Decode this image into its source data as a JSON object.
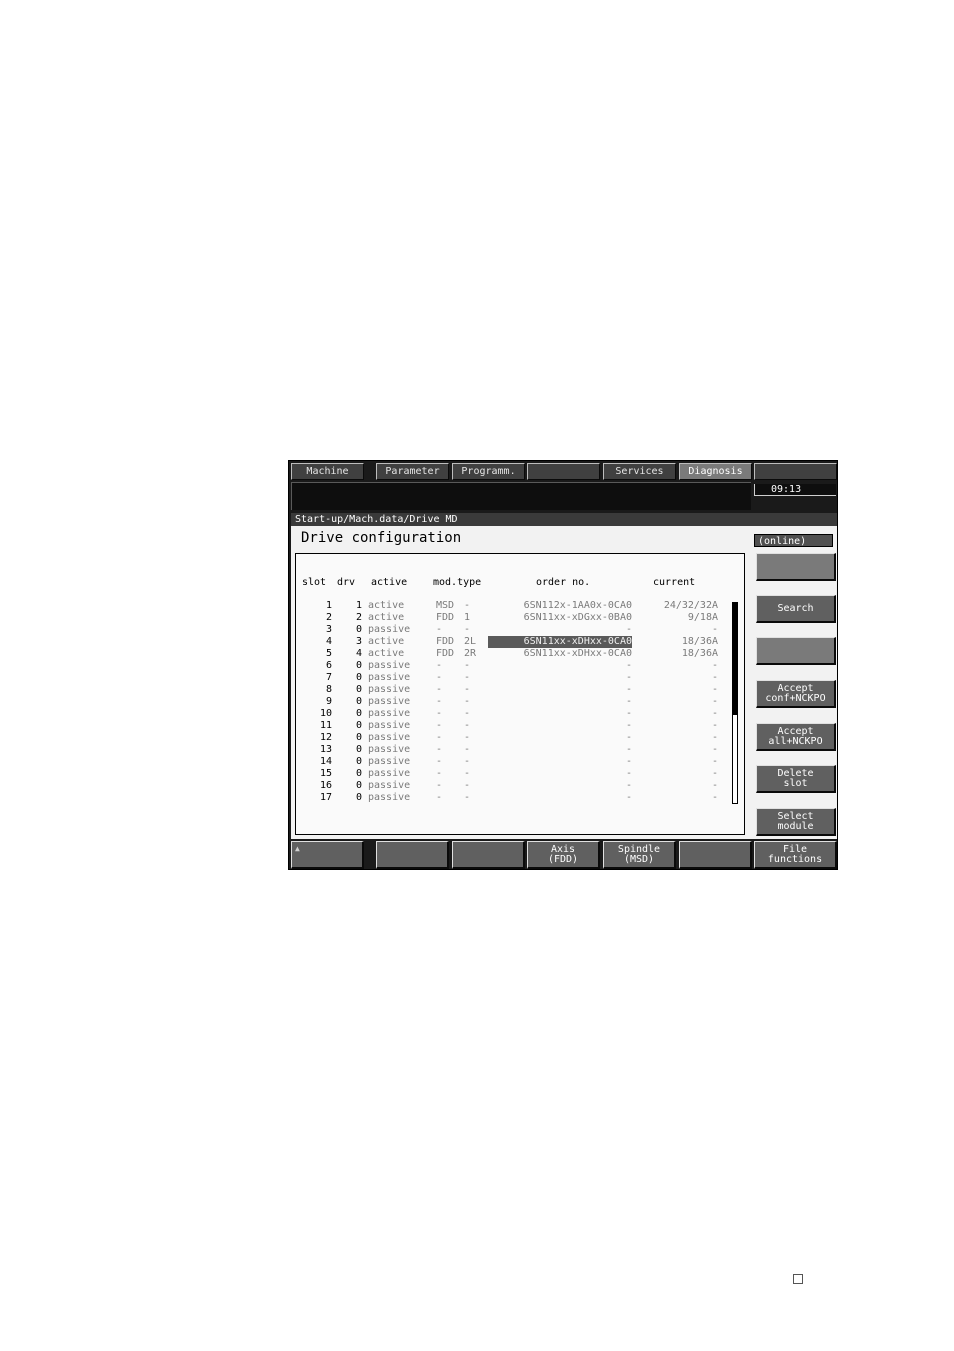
{
  "tabs": [
    {
      "label": "Machine",
      "selected": false
    },
    {
      "label": "Parameter",
      "selected": false
    },
    {
      "label": "Programm.",
      "selected": false
    },
    {
      "label": "",
      "selected": false
    },
    {
      "label": "Services",
      "selected": false
    },
    {
      "label": "Diagnosis",
      "selected": true
    },
    {
      "label": "",
      "selected": false
    }
  ],
  "clock": "09:13",
  "breadcrumb": "Start-up/Mach.data/Drive MD",
  "title": "Drive configuration",
  "status": "(online)",
  "table": {
    "headers": {
      "slot": "slot",
      "drv": "drv",
      "active": "active",
      "mod_type": "mod.type",
      "order_no": "order no.",
      "current": "current"
    },
    "rows": [
      {
        "slot": "1",
        "drv": "1",
        "active": "active",
        "mod": "MSD",
        "mod2": "-",
        "order": "6SN112x-1AA0x-0CA0",
        "current": "24/32/32A"
      },
      {
        "slot": "2",
        "drv": "2",
        "active": "active",
        "mod": "FDD",
        "mod2": "1",
        "order": "6SN11xx-xDGxx-0BA0",
        "current": "9/18A"
      },
      {
        "slot": "3",
        "drv": "0",
        "active": "passive",
        "mod": "-",
        "mod2": "-",
        "order": "-",
        "current": "-"
      },
      {
        "slot": "4",
        "drv": "3",
        "active": "active",
        "mod": "FDD",
        "mod2": "2L",
        "order": "6SN11xx-xDHxx-0CA0",
        "current": "18/36A"
      },
      {
        "slot": "5",
        "drv": "4",
        "active": "active",
        "mod": "FDD",
        "mod2": "2R",
        "order": "6SN11xx-xDHxx-0CA0",
        "current": "18/36A"
      },
      {
        "slot": "6",
        "drv": "0",
        "active": "passive",
        "mod": "-",
        "mod2": "-",
        "order": "-",
        "current": "-"
      },
      {
        "slot": "7",
        "drv": "0",
        "active": "passive",
        "mod": "-",
        "mod2": "-",
        "order": "-",
        "current": "-"
      },
      {
        "slot": "8",
        "drv": "0",
        "active": "passive",
        "mod": "-",
        "mod2": "-",
        "order": "-",
        "current": "-"
      },
      {
        "slot": "9",
        "drv": "0",
        "active": "passive",
        "mod": "-",
        "mod2": "-",
        "order": "-",
        "current": "-"
      },
      {
        "slot": "10",
        "drv": "0",
        "active": "passive",
        "mod": "-",
        "mod2": "-",
        "order": "-",
        "current": "-"
      },
      {
        "slot": "11",
        "drv": "0",
        "active": "passive",
        "mod": "-",
        "mod2": "-",
        "order": "-",
        "current": "-"
      },
      {
        "slot": "12",
        "drv": "0",
        "active": "passive",
        "mod": "-",
        "mod2": "-",
        "order": "-",
        "current": "-"
      },
      {
        "slot": "13",
        "drv": "0",
        "active": "passive",
        "mod": "-",
        "mod2": "-",
        "order": "-",
        "current": "-"
      },
      {
        "slot": "14",
        "drv": "0",
        "active": "passive",
        "mod": "-",
        "mod2": "-",
        "order": "-",
        "current": "-"
      },
      {
        "slot": "15",
        "drv": "0",
        "active": "passive",
        "mod": "-",
        "mod2": "-",
        "order": "-",
        "current": "-"
      },
      {
        "slot": "16",
        "drv": "0",
        "active": "passive",
        "mod": "-",
        "mod2": "-",
        "order": "-",
        "current": "-"
      },
      {
        "slot": "17",
        "drv": "0",
        "active": "passive",
        "mod": "-",
        "mod2": "-",
        "order": "-",
        "current": "-"
      }
    ],
    "highlighted_row": "4"
  },
  "vertical_softkeys": [
    {
      "label": "",
      "name": "softkey-v1"
    },
    {
      "label": "Search",
      "name": "search-button"
    },
    {
      "label": "",
      "name": "softkey-v3"
    },
    {
      "label": "Accept\nconf+NCKPO",
      "name": "accept-conf-nckpo-button"
    },
    {
      "label": "Accept\nall+NCKPO",
      "name": "accept-all-nckpo-button"
    },
    {
      "label": "Delete\nslot",
      "name": "delete-slot-button"
    },
    {
      "label": "Select\nmodule",
      "name": "select-module-button"
    }
  ],
  "horizontal_softkeys": [
    {
      "label": "",
      "name": "softkey-h1"
    },
    {
      "label": "",
      "name": "softkey-h2"
    },
    {
      "label": "",
      "name": "softkey-h3"
    },
    {
      "label": "Axis\n(FDD)",
      "name": "axis-fdd-button"
    },
    {
      "label": "Spindle\n(MSD)",
      "name": "spindle-msd-button"
    },
    {
      "label": "",
      "name": "softkey-h6"
    },
    {
      "label": "File\nfunctions",
      "name": "file-functions-button"
    }
  ],
  "recall_symbol": "▲"
}
